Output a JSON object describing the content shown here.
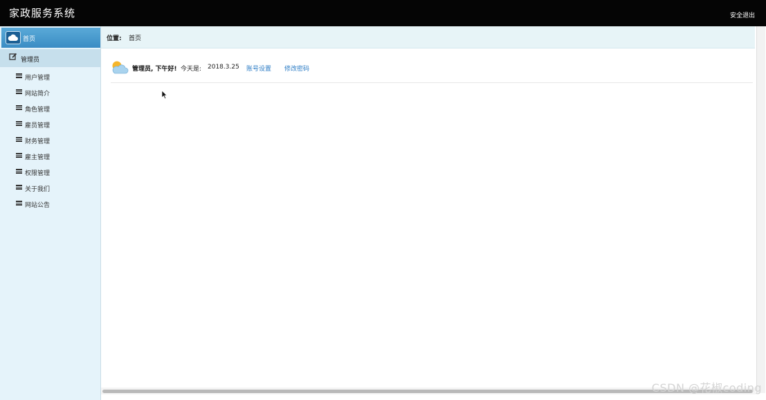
{
  "header": {
    "title": "家政服务系统",
    "logout_label": "安全退出"
  },
  "sidebar": {
    "home_label": "首页",
    "group_label": "管理员",
    "items": [
      {
        "label": "用户管理"
      },
      {
        "label": "网站简介"
      },
      {
        "label": "角色管理"
      },
      {
        "label": "雇员管理"
      },
      {
        "label": "财务管理"
      },
      {
        "label": "雇主管理"
      },
      {
        "label": "权限管理"
      },
      {
        "label": "关于我们"
      },
      {
        "label": "网站公告"
      }
    ]
  },
  "breadcrumb": {
    "label": "位置:",
    "current": "首页"
  },
  "welcome": {
    "greeting": "管理员, 下午好!",
    "today_label": "今天是:",
    "date": "2018.3.25",
    "account_link": "账号设置",
    "password_link": "修改密码"
  },
  "watermark": "CSDN @花椒coding",
  "colors": {
    "topbar": "#050505",
    "sidebar": "#e5f3fa",
    "sidebar_active": "#3a8cc4",
    "link": "#2c7cc5"
  },
  "icons": {
    "home": "cloud-icon",
    "group": "edit-icon",
    "menu_item": "list-icon",
    "welcome": "weather-icon"
  }
}
